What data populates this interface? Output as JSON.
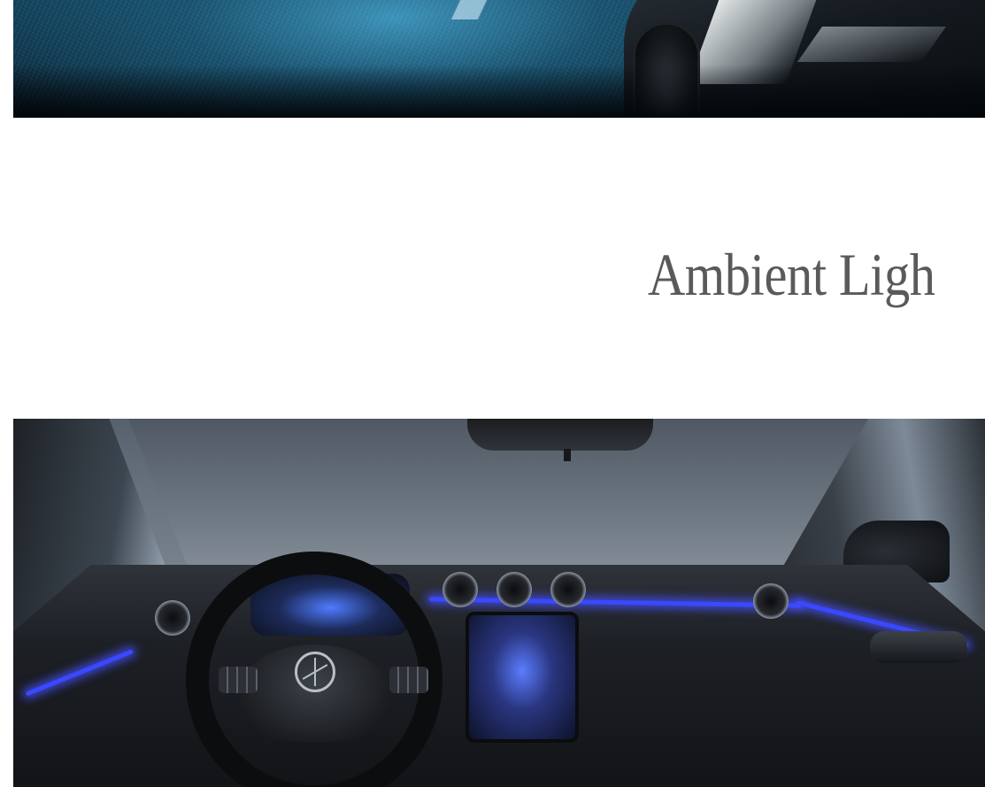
{
  "page": {
    "hero_top_image": {
      "alt": ""
    },
    "section": {
      "heading": "Ambient Ligh"
    },
    "interior_image": {
      "alt": ""
    }
  },
  "colors": {
    "background": "#ffffff",
    "heading_text": "#5a5a5a",
    "ambient_light": "#3a48ff"
  }
}
